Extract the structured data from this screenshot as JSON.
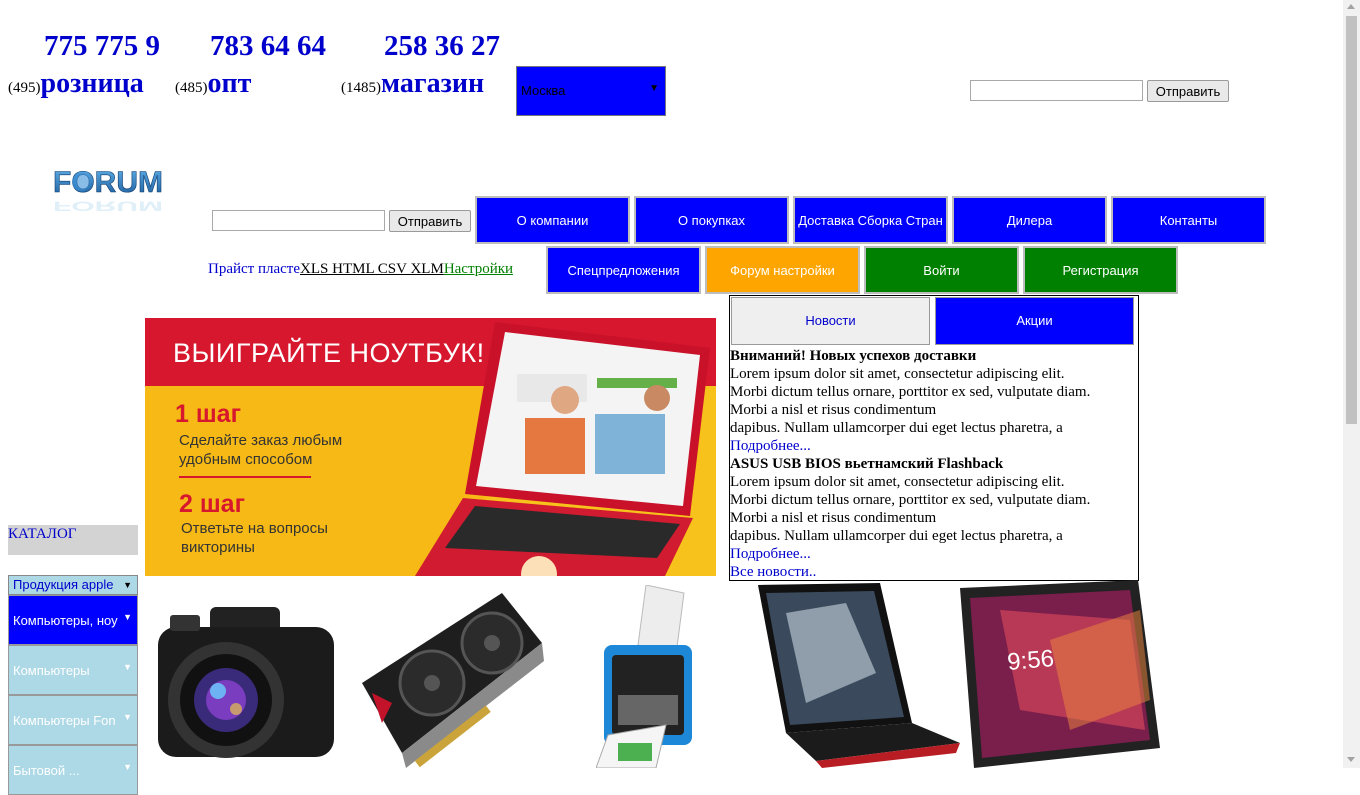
{
  "header": {
    "phones": [
      "775 775 9",
      "783 64 64",
      "258 36 27"
    ],
    "departments": [
      {
        "code": "(495)",
        "label": "розница"
      },
      {
        "code": "(485)",
        "label": "опт"
      },
      {
        "code": "(1485)",
        "label": "магазин"
      }
    ],
    "city_select": {
      "value": "Москва"
    },
    "top_search": {
      "placeholder": "",
      "button": "Отправить"
    }
  },
  "logo": {
    "text": "FORUM"
  },
  "second_search": {
    "placeholder": "",
    "button": "Отправить"
  },
  "nav_main": [
    "О компании",
    "О покупках",
    "Доставка Сборка Стран",
    "Дилера",
    "Контанты"
  ],
  "price_links": {
    "prefix": "Прайст пласте",
    "formats": "XLS HTML CSV XLM",
    "settings": "Настройки"
  },
  "nav_secondary": [
    "Спецпредложения",
    "Форум настройки",
    "Войти",
    "Регистрация"
  ],
  "banner": {
    "title": "ВЫИГРАЙТЕ НОУТБУК!",
    "step1_title": "1 шаг",
    "step1_text_1": "Сделайте заказ любым",
    "step1_text_2": "удобным способом",
    "step2_title": "2 шаг",
    "step2_text_1": "Ответьте на вопросы",
    "step2_text_2": "викторины"
  },
  "news": {
    "tabs": [
      "Новости",
      "Акции"
    ],
    "items": [
      {
        "title": "Вниманий! Новых успехов доставки",
        "lines": [
          "Lorem ipsum dolor sit amet, consectetur adipiscing elit.",
          "Morbi dictum tellus ornare, porttitor ex sed, vulputate diam.",
          "Morbi a nisl et risus condimentum",
          "dapibus. Nullam ullamcorper dui eget lectus pharetra, a"
        ],
        "more": "Подробнее..."
      },
      {
        "title": "ASUS USB BIOS вьетнамский Flashback",
        "lines": [
          "Lorem ipsum dolor sit amet, consectetur adipiscing elit.",
          "Morbi dictum tellus ornare, porttitor ex sed, vulputate diam.",
          "Morbi a nisl et risus condimentum",
          "dapibus. Nullam ullamcorper dui eget lectus pharetra, a"
        ],
        "more": "Подробнее..."
      }
    ],
    "all": "Все новости.."
  },
  "catalog": {
    "title": "КАТАЛОГ",
    "select": "Продукция apple",
    "items": [
      "Компьютеры, ноу",
      "Компьютеры",
      "Компьютеры Fon",
      "Бытовой ..."
    ]
  },
  "products": [
    "camera-image",
    "graphics-card-image",
    "printer-image",
    "laptop-image",
    "tablet-image"
  ]
}
